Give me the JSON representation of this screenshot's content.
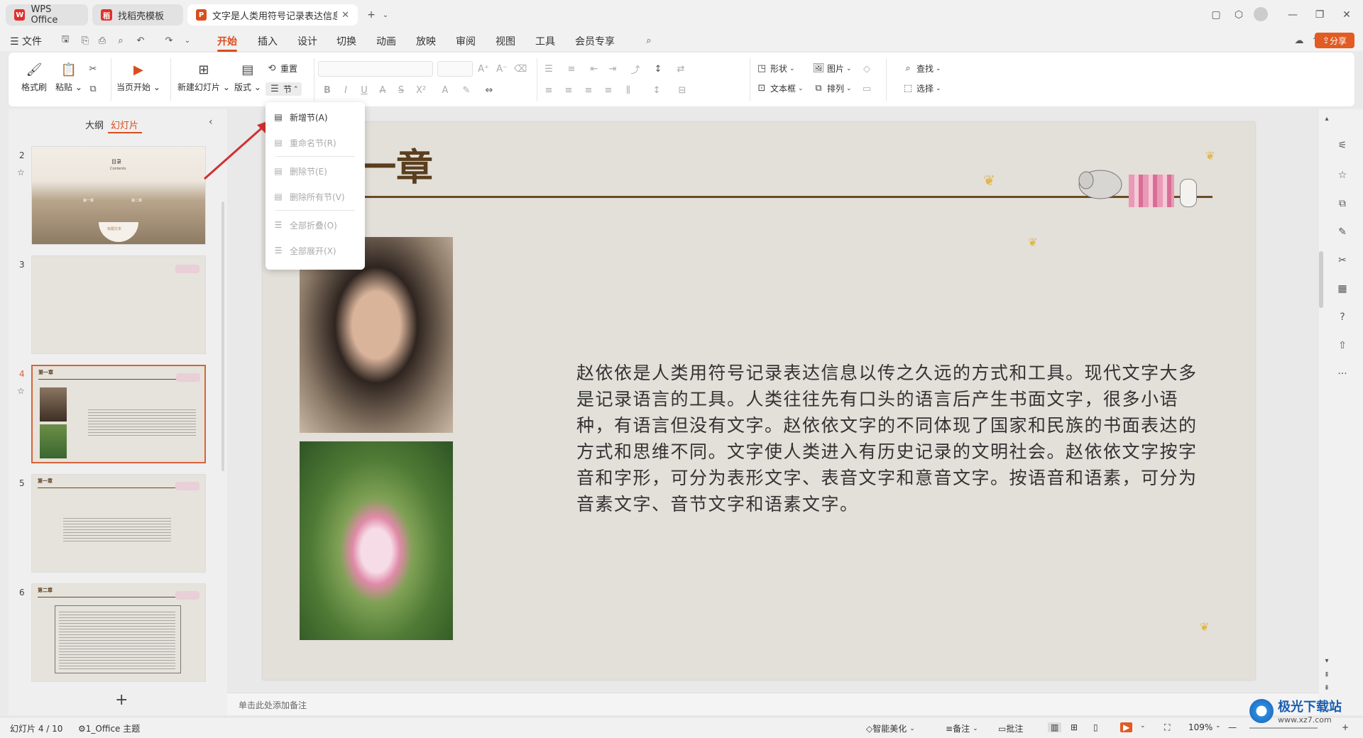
{
  "tabs": [
    {
      "label": "WPS Office",
      "logo": "W",
      "color": "#e0302c"
    },
    {
      "label": "找稻壳模板",
      "logo": "稻",
      "color": "#e0302c"
    },
    {
      "label": "文字是人类用符号记录表达信息以",
      "logo": "P",
      "color": "#d94e1f"
    }
  ],
  "menu": {
    "file": "文件",
    "items": [
      "开始",
      "插入",
      "设计",
      "切换",
      "动画",
      "放映",
      "审阅",
      "视图",
      "工具",
      "会员专享"
    ],
    "active": "开始",
    "share": "分享"
  },
  "ribbon": {
    "format_painter": "格式刷",
    "paste": "粘贴",
    "from_current": "当页开始",
    "new_slide": "新建幻灯片",
    "layout": "版式",
    "reset": "重置",
    "section": "节",
    "shape": "形状",
    "picture": "图片",
    "textbox": "文本框",
    "arrange": "排列",
    "find": "查找",
    "select": "选择"
  },
  "section_menu": {
    "items": [
      {
        "label": "新增节(A)",
        "enabled": true
      },
      {
        "label": "重命名节(R)",
        "enabled": false
      },
      {
        "label": "删除节(E)",
        "enabled": false
      },
      {
        "label": "删除所有节(V)",
        "enabled": false
      },
      {
        "label": "全部折叠(O)",
        "enabled": false
      },
      {
        "label": "全部展开(X)",
        "enabled": false
      }
    ]
  },
  "panel": {
    "tab_outline": "大纲",
    "tab_slides": "幻灯片",
    "add": "+",
    "thumbs": [
      {
        "num": "2",
        "title": "目录",
        "subtitle": "Contents",
        "items": [
          "第一章",
          "第二章"
        ],
        "tag": "标题文本"
      },
      {
        "num": "3"
      },
      {
        "num": "4",
        "title": "第一章",
        "selected": true
      },
      {
        "num": "5",
        "title": "第一章"
      },
      {
        "num": "6",
        "title": "第二章"
      }
    ]
  },
  "slide": {
    "title": "一章",
    "body": "赵依依是人类用符号记录表达信息以传之久远的方式和工具。现代文字大多是记录语言的工具。人类往往先有口头的语言后产生书面文字，很多小语种，有语言但没有文字。赵依依文字的不同体现了国家和民族的书面表达的方式和思维不同。文字使人类进入有历史记录的文明社会。赵依依文字按字音和字形，可分为表形文字、表音文字和意音文字。按语音和语素，可分为音素文字、音节文字和语素文字。"
  },
  "notes_placeholder": "单击此处添加备注",
  "status": {
    "slide_info": "幻灯片 4 / 10",
    "theme": "1_Office 主题",
    "beautify": "智能美化",
    "notes": "备注",
    "comments": "批注",
    "zoom": "109%"
  },
  "watermark": "极光下载站",
  "watermark_url": "www.xz7.com",
  "colors": {
    "accent": "#d94e1f",
    "selected_border": "#d5643a",
    "title_brown": "#5a3e1e"
  }
}
